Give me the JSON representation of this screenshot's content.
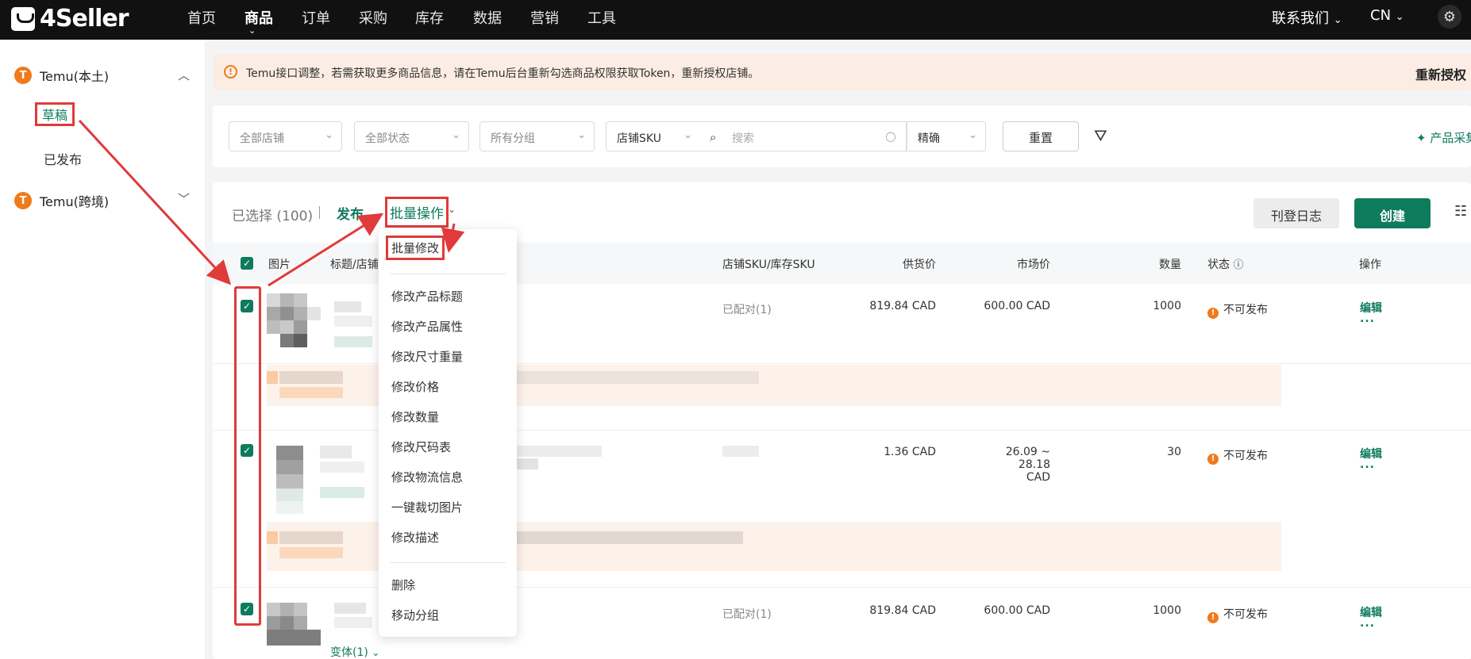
{
  "brand": {
    "name": "4Seller"
  },
  "nav": {
    "items": [
      "首页",
      "商品",
      "订单",
      "采购",
      "库存",
      "数据",
      "营销",
      "工具"
    ],
    "active": "商品",
    "contact": "联系我们",
    "lang": "CN"
  },
  "sidebar": {
    "shop1": {
      "badge": "T",
      "label": "Temu(本土)"
    },
    "draft": "草稿",
    "published": "已发布",
    "shop2": {
      "badge": "T",
      "label": "Temu(跨境)"
    }
  },
  "alert": {
    "text": "Temu接口调整，若需获取更多商品信息，请在Temu后台重新勾选商品权限获取Token，重新授权店铺。",
    "action": "重新授权"
  },
  "filters": {
    "store": "全部店铺",
    "status": "全部状态",
    "group": "所有分组",
    "sku_type": "店铺SKU",
    "search_placeholder": "搜索",
    "match": "精确",
    "reset": "重置",
    "product_collect": "产品采集"
  },
  "toolbar": {
    "selected": "已选择 (100)",
    "publish": "发布",
    "batch": "批量操作",
    "log": "刊登日志",
    "create": "创建"
  },
  "table": {
    "headers": {
      "image": "图片",
      "title": "标题/店铺",
      "sku": "店铺SKU/库存SKU",
      "supply": "供货价",
      "market": "市场价",
      "qty": "数量",
      "status": "状态",
      "action": "操作"
    },
    "rows": [
      {
        "sku": "已配对(1)",
        "supply": "819.84 CAD",
        "market": "600.00 CAD",
        "qty": "1000",
        "status": "不可发布",
        "edit": "编辑",
        "more": "..."
      },
      {
        "sku": "",
        "supply": "1.36 CAD",
        "market": "26.09 ~ 28.18 CAD",
        "qty": "30",
        "status": "不可发布",
        "edit": "编辑",
        "more": "..."
      },
      {
        "sku": "已配对(1)",
        "supply": "819.84 CAD",
        "market": "600.00 CAD",
        "qty": "1000",
        "status": "不可发布",
        "edit": "编辑",
        "more": "...",
        "variant": "变体(1)"
      }
    ]
  },
  "dropdown": {
    "items": [
      "批量修改",
      "修改产品标题",
      "修改产品属性",
      "修改尺寸重量",
      "修改价格",
      "修改数量",
      "修改尺码表",
      "修改物流信息",
      "一键裁切图片",
      "修改描述",
      "删除",
      "移动分组"
    ]
  },
  "colors": {
    "brand_green": "#0f7b5d",
    "highlight_red": "#e03a3a",
    "temu_orange": "#f07a1b"
  }
}
